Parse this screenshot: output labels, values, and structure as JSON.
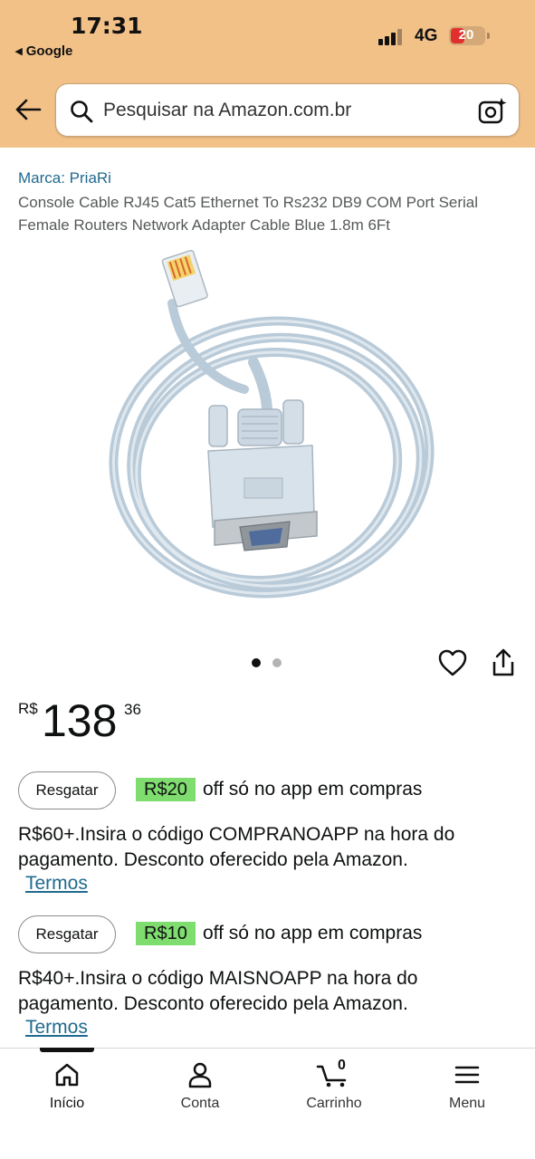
{
  "status_bar": {
    "time": "17:31",
    "back_app": "◂ Google",
    "network": "4G",
    "battery_level": "20",
    "battery_percent": 20,
    "battery_color": "#e0302e"
  },
  "header": {
    "background": "#f2c188",
    "search_placeholder": "Pesquisar na Amazon.com.br"
  },
  "product": {
    "brand": "Marca: PriaRi",
    "title": "Console Cable RJ45 Cat5 Ethernet To Rs232 DB9 COM Port Serial Female Routers Network Adapter Cable Blue 1.8m 6Ft",
    "image_icon": "console-cable-product-image",
    "image_index": 1,
    "image_count": 2,
    "price": {
      "currency": "R$",
      "whole": "138",
      "cents": "36"
    }
  },
  "coupons": [
    {
      "button_label": "Resgatar",
      "amount": "R$20",
      "off_text": "off só no app em compras",
      "description": "R$60+.Insira o código COMPRANOAPP na hora do pagamento. Desconto oferecido pela Amazon.",
      "terms_label": "Termos"
    },
    {
      "button_label": "Resgatar",
      "amount": "R$10",
      "off_text": "off só no app em compras",
      "description": "R$40+.Insira o código MAISNOAPP na hora do pagamento. Desconto oferecido pela Amazon.",
      "terms_label": "Termos"
    }
  ],
  "bottom_nav": {
    "items": [
      {
        "label": "Início",
        "icon": "home-icon",
        "active": true
      },
      {
        "label": "Conta",
        "icon": "person-icon",
        "active": false
      },
      {
        "label": "Carrinho",
        "icon": "cart-icon",
        "active": false
      },
      {
        "label": "Menu",
        "icon": "menu-icon",
        "active": false
      }
    ],
    "cart_count": "0"
  },
  "colors": {
    "link": "#1f6a8f",
    "coupon_badge": "#7fdc6e",
    "active_dot": "#111111",
    "inactive_dot": "#b3b3b3"
  }
}
